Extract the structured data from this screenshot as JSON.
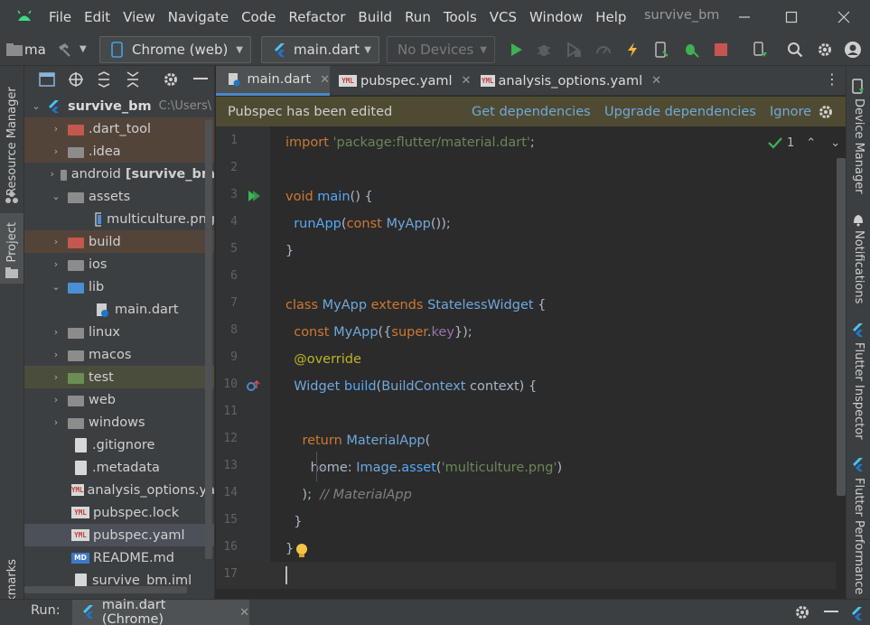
{
  "menubar": {
    "items": [
      "File",
      "Edit",
      "View",
      "Navigate",
      "Code",
      "Refactor",
      "Build",
      "Run",
      "Tools",
      "VCS",
      "Window",
      "Help"
    ],
    "window_title": "survive_bm"
  },
  "toolbar": {
    "project_short": "ma",
    "run_config": "Chrome (web)",
    "file_config": "main.dart",
    "device": "No Devices"
  },
  "left_stripe": {
    "resource_manager": "Resource Manager",
    "project": "Project",
    "bookmarks": "Bookmarks"
  },
  "project_tree": {
    "root_name": "survive_bm",
    "root_path": "C:\\Users\\",
    "rows": [
      {
        "label": "survive_bm",
        "extra": "C:\\Users\\",
        "type": "root"
      },
      {
        "label": ".dart_tool",
        "type": "folder",
        "hl": "orange"
      },
      {
        "label": ".idea",
        "type": "folder-gear",
        "hl": "orange"
      },
      {
        "label": "android",
        "extra": "[survive_bm",
        "type": "folder"
      },
      {
        "label": "assets",
        "type": "folder",
        "open": true
      },
      {
        "label": "multiculture.png",
        "type": "image"
      },
      {
        "label": "build",
        "type": "folder-gear",
        "hl": "orange"
      },
      {
        "label": "ios",
        "type": "folder"
      },
      {
        "label": "lib",
        "type": "folder-blue",
        "open": true
      },
      {
        "label": "main.dart",
        "type": "dart"
      },
      {
        "label": "linux",
        "type": "folder"
      },
      {
        "label": "macos",
        "type": "folder"
      },
      {
        "label": "test",
        "type": "folder-test",
        "hl": "green"
      },
      {
        "label": "web",
        "type": "folder-web"
      },
      {
        "label": "windows",
        "type": "folder"
      },
      {
        "label": ".gitignore",
        "type": "file"
      },
      {
        "label": ".metadata",
        "type": "file"
      },
      {
        "label": "analysis_options.yaml",
        "type": "yml"
      },
      {
        "label": "pubspec.lock",
        "type": "yml"
      },
      {
        "label": "pubspec.yaml",
        "type": "yml",
        "selected": true
      },
      {
        "label": "README.md",
        "type": "md"
      },
      {
        "label": "survive_bm.iml",
        "type": "file"
      }
    ]
  },
  "editor": {
    "tabs": [
      {
        "label": "main.dart",
        "active": true
      },
      {
        "label": "pubspec.yaml"
      },
      {
        "label": "analysis_options.yaml"
      }
    ],
    "banner": {
      "text": "Pubspec has been edited",
      "get_deps": "Get dependencies",
      "upgrade_deps": "Upgrade dependencies",
      "ignore": "Ignore"
    },
    "inspection_count": "1",
    "line_numbers": [
      "1",
      "2",
      "3",
      "4",
      "5",
      "6",
      "7",
      "8",
      "9",
      "10",
      "11",
      "12",
      "13",
      "14",
      "15",
      "16",
      "17"
    ]
  },
  "right_stripe": {
    "device_manager": "Device Manager",
    "notifications": "Notifications",
    "flutter_inspector": "Flutter Inspector",
    "flutter_performance": "Flutter Performance"
  },
  "runbar": {
    "label": "Run:",
    "tab": "main.dart (Chrome)"
  },
  "colors": {
    "accent": "#4a88c7",
    "run_green": "#3db254",
    "stop_red": "#c75450"
  }
}
